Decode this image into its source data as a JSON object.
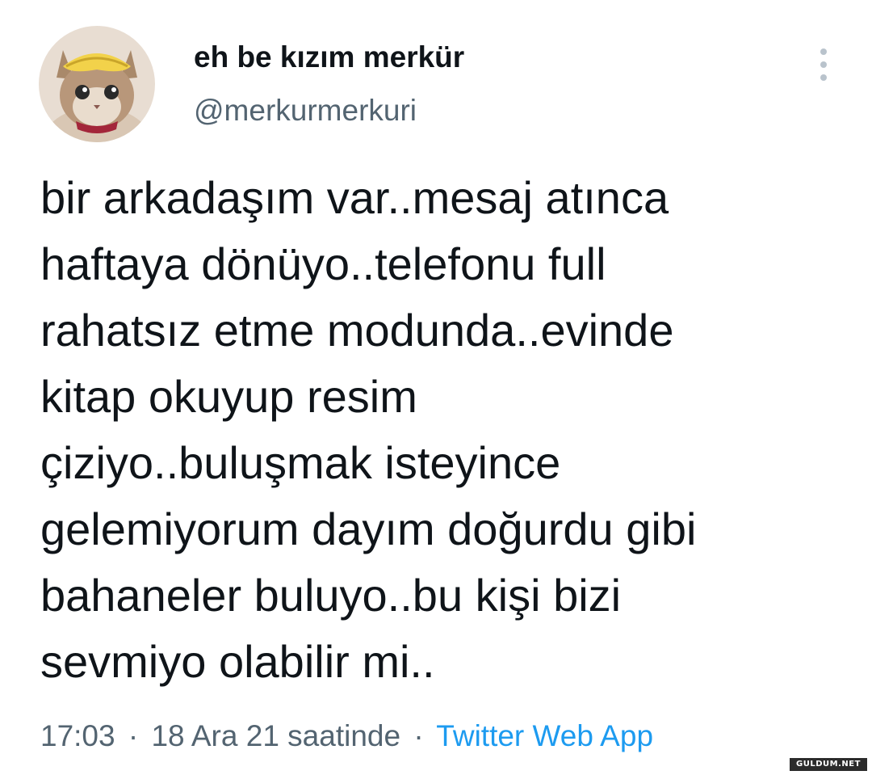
{
  "author": {
    "display_name": "eh be kızım merkür",
    "handle": "@merkurmerkuri",
    "avatar_icon": "kitten-with-banana-hat-avatar"
  },
  "more_icon": "more-vertical-icon",
  "tweet": {
    "lines": [
      "bir arkadaşım var..mesaj atınca",
      "haftaya dönüyo..telefonu full",
      "rahatsız etme modunda..evinde",
      "kitap okuyup resim",
      "çiziyo..buluşmak isteyince",
      "gelemiyorum dayım doğurdu gibi",
      "bahaneler buluyo..bu kişi bizi",
      "sevmiyo olabilir mi.."
    ]
  },
  "meta": {
    "time": "17:03",
    "separator": "·",
    "date": "18 Ara 21 saatinde",
    "source": "Twitter Web App"
  },
  "watermark": "GULDUM.NET",
  "colors": {
    "text": "#0f1419",
    "secondary": "#536471",
    "link": "#1d9bf0",
    "dots": "#b9c3cc"
  }
}
